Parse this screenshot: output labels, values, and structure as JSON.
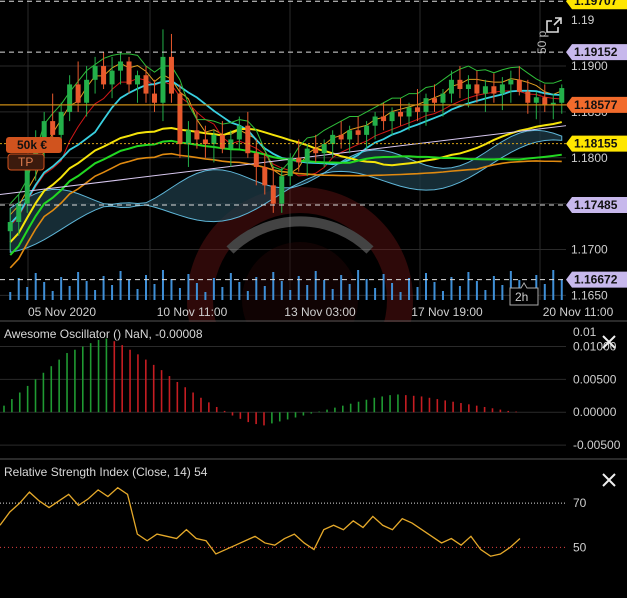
{
  "colors": {
    "background": "#000000",
    "grid": "#2a2a2a",
    "up_candle": "#23b04a",
    "down_candle": "#e8592d",
    "ask_line": "#d4a017",
    "bid_line": "#f5d20a",
    "badge_white": "#c7b8ec",
    "badge_orange": "#f26b2c",
    "badge_yellow": "#ffe600",
    "ao_up": "#1f9a32",
    "ao_down": "#c61d22",
    "rsi_line": "#e5a92a",
    "rsi_level": "#e04040"
  },
  "price_panel": {
    "price_badges": [
      {
        "value": "1.19707",
        "style": "yellow"
      },
      {
        "value": "1.19152",
        "style": "white"
      },
      {
        "value": "1.18577",
        "style": "orange"
      },
      {
        "value": "1.18155",
        "style": "yellow"
      },
      {
        "value": "1.17485",
        "style": "white"
      },
      {
        "value": "1.16672",
        "style": "white"
      }
    ],
    "price_ticks": [
      "1.19",
      "1.1900",
      "1.1850",
      "1.1800",
      "1.1700",
      "1.1650"
    ],
    "time_ticks": [
      "05 Nov 2020",
      "10 Nov 11:00",
      "13 Nov 03:00",
      "17 Nov 19:00",
      "20 Nov 11:00"
    ],
    "position_label": "50k €",
    "tp_label": "TP",
    "range_label": "50 p",
    "timeframe_label": "2h",
    "expand_icon": "expand-icon"
  },
  "ao_panel": {
    "title": "Awesome Oscillator () NaN, -0.00008",
    "ticks": [
      "0.01",
      "0.01000",
      "0.00500",
      "0.00000",
      "-0.00500"
    ]
  },
  "rsi_panel": {
    "title": "Relative Strength Index (Close, 14) 54",
    "ticks": [
      "70",
      "50"
    ]
  },
  "chart_data": {
    "type": "candlestick",
    "ylim": [
      1.1645,
      1.1972
    ],
    "candles": [
      [
        1.172,
        1.1745,
        1.17,
        1.173
      ],
      [
        1.173,
        1.176,
        1.1715,
        1.175
      ],
      [
        1.175,
        1.18,
        1.174,
        1.179
      ],
      [
        1.179,
        1.183,
        1.1775,
        1.182
      ],
      [
        1.182,
        1.185,
        1.18,
        1.184
      ],
      [
        1.184,
        1.187,
        1.182,
        1.1825
      ],
      [
        1.1825,
        1.186,
        1.181,
        1.185
      ],
      [
        1.185,
        1.189,
        1.184,
        1.188
      ],
      [
        1.188,
        1.1905,
        1.185,
        1.186
      ],
      [
        1.186,
        1.19,
        1.1845,
        1.1885
      ],
      [
        1.1885,
        1.191,
        1.187,
        1.19
      ],
      [
        1.19,
        1.1915,
        1.1875,
        1.188
      ],
      [
        1.188,
        1.191,
        1.1865,
        1.1895
      ],
      [
        1.1895,
        1.1915,
        1.188,
        1.1905
      ],
      [
        1.1905,
        1.191,
        1.187,
        1.188
      ],
      [
        1.188,
        1.1895,
        1.186,
        1.189
      ],
      [
        1.189,
        1.19,
        1.186,
        1.187
      ],
      [
        1.187,
        1.1885,
        1.185,
        1.186
      ],
      [
        1.186,
        1.194,
        1.184,
        1.191
      ],
      [
        1.191,
        1.1935,
        1.186,
        1.187
      ],
      [
        1.187,
        1.188,
        1.18,
        1.1815
      ],
      [
        1.1815,
        1.184,
        1.179,
        1.183
      ],
      [
        1.183,
        1.185,
        1.181,
        1.182
      ],
      [
        1.182,
        1.1835,
        1.18,
        1.1815
      ],
      [
        1.1815,
        1.183,
        1.1795,
        1.1825
      ],
      [
        1.1825,
        1.184,
        1.1805,
        1.181
      ],
      [
        1.181,
        1.183,
        1.179,
        1.182
      ],
      [
        1.182,
        1.1845,
        1.181,
        1.1835
      ],
      [
        1.1835,
        1.185,
        1.18,
        1.1805
      ],
      [
        1.1805,
        1.182,
        1.177,
        1.179
      ],
      [
        1.179,
        1.1805,
        1.176,
        1.177
      ],
      [
        1.177,
        1.179,
        1.174,
        1.175
      ],
      [
        1.175,
        1.179,
        1.174,
        1.178
      ],
      [
        1.178,
        1.1805,
        1.177,
        1.18
      ],
      [
        1.18,
        1.182,
        1.1785,
        1.1795
      ],
      [
        1.1795,
        1.1815,
        1.178,
        1.181
      ],
      [
        1.181,
        1.1825,
        1.1795,
        1.1805
      ],
      [
        1.1805,
        1.182,
        1.179,
        1.1815
      ],
      [
        1.1815,
        1.183,
        1.18,
        1.1825
      ],
      [
        1.1825,
        1.184,
        1.181,
        1.182
      ],
      [
        1.182,
        1.1835,
        1.1805,
        1.183
      ],
      [
        1.183,
        1.1845,
        1.1815,
        1.1825
      ],
      [
        1.1825,
        1.184,
        1.181,
        1.1835
      ],
      [
        1.1835,
        1.185,
        1.182,
        1.1845
      ],
      [
        1.1845,
        1.186,
        1.183,
        1.184
      ],
      [
        1.184,
        1.1855,
        1.1825,
        1.185
      ],
      [
        1.185,
        1.1865,
        1.1835,
        1.1845
      ],
      [
        1.1845,
        1.186,
        1.183,
        1.1855
      ],
      [
        1.1855,
        1.1875,
        1.184,
        1.185
      ],
      [
        1.185,
        1.187,
        1.1835,
        1.1865
      ],
      [
        1.1865,
        1.188,
        1.185,
        1.186
      ],
      [
        1.186,
        1.1875,
        1.1845,
        1.187
      ],
      [
        1.187,
        1.1895,
        1.186,
        1.1885
      ],
      [
        1.1885,
        1.19,
        1.1865,
        1.1875
      ],
      [
        1.1875,
        1.189,
        1.1855,
        1.188
      ],
      [
        1.188,
        1.1895,
        1.186,
        1.187
      ],
      [
        1.187,
        1.1885,
        1.185,
        1.1878
      ],
      [
        1.1878,
        1.1892,
        1.186,
        1.187
      ],
      [
        1.187,
        1.1888,
        1.1852,
        1.188
      ],
      [
        1.188,
        1.1895,
        1.186,
        1.1885
      ],
      [
        1.1885,
        1.19,
        1.1868,
        1.1872
      ],
      [
        1.1872,
        1.1885,
        1.1848,
        1.186
      ],
      [
        1.186,
        1.1872,
        1.1842,
        1.1866
      ],
      [
        1.1866,
        1.188,
        1.185,
        1.1858
      ],
      [
        1.1858,
        1.187,
        1.1842,
        1.186
      ],
      [
        1.186,
        1.188,
        1.1848,
        1.1876
      ]
    ],
    "ao_values": [
      0.001,
      0.002,
      0.003,
      0.004,
      0.005,
      0.006,
      0.007,
      0.008,
      0.009,
      0.0095,
      0.01,
      0.0105,
      0.011,
      0.0112,
      0.0108,
      0.0102,
      0.0095,
      0.0088,
      0.008,
      0.0072,
      0.0064,
      0.0055,
      0.0046,
      0.0038,
      0.003,
      0.0022,
      0.0015,
      0.0008,
      0.0002,
      -0.0005,
      -0.001,
      -0.0015,
      -0.0018,
      -0.002,
      -0.0017,
      -0.0014,
      -0.0011,
      -0.0008,
      -0.0005,
      -0.0002,
      0.0001,
      0.0004,
      0.0007,
      0.001,
      0.0013,
      0.0016,
      0.0019,
      0.0022,
      0.0024,
      0.0026,
      0.0027,
      0.0026,
      0.0025,
      0.0024,
      0.0022,
      0.002,
      0.0018,
      0.0016,
      0.0014,
      0.0012,
      0.001,
      0.0008,
      0.0006,
      0.0004,
      0.0002,
      0.0001
    ],
    "rsi_values": [
      60,
      66,
      70,
      75,
      71,
      68,
      71,
      74,
      69,
      72,
      76,
      73,
      77,
      74,
      56,
      53,
      56,
      55,
      54,
      58,
      54,
      53,
      47,
      49,
      51,
      53,
      55,
      52,
      51,
      54,
      56,
      52,
      49,
      58,
      60,
      58,
      62,
      59,
      64,
      60,
      58,
      63,
      61,
      58,
      55,
      52,
      54,
      51,
      55,
      49,
      46,
      47,
      50,
      54
    ]
  }
}
